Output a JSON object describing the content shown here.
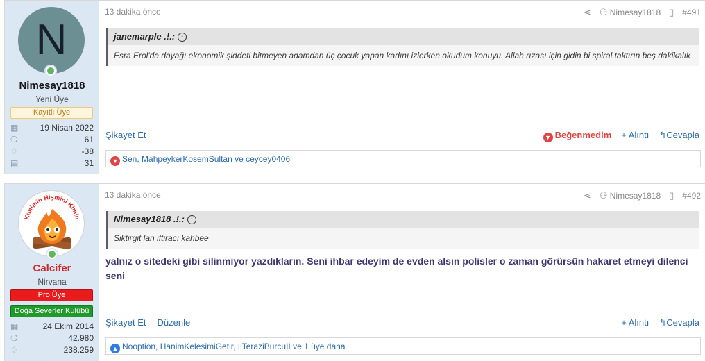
{
  "post1": {
    "user": {
      "avatar_letter": "N",
      "avatar_color": "#6b8f92",
      "username": "Nimesay1818",
      "user_title": "Yeni Üye",
      "banner": "Kayıtlı Üye",
      "stats": [
        {
          "icon": "calendar-icon",
          "value": "19 Nisan 2022"
        },
        {
          "icon": "messages-icon",
          "value": "61"
        },
        {
          "icon": "thumbs-up-icon",
          "value": "-38"
        },
        {
          "icon": "id-card-icon",
          "value": "31"
        }
      ]
    },
    "time": "13 dakika önce",
    "author": "Nimesay1818",
    "number": "#491",
    "quote": {
      "author": "janemarple .!.:",
      "text": "Esra Erol'da dayağı ekonomik şiddeti bitmeyen adamdan üç çocuk yapan kadını izlerken okudum konuyu. Allah rızası için gidin bi spiral taktırın beş dakikalık"
    },
    "footer": {
      "report": "Şikayet Et",
      "dislike": "Beğenmedim",
      "quote": "+ Alıntı",
      "reply": "Cevapla"
    },
    "reactions": "Sen, MahpeykerKosemSultan ve ceycey0406"
  },
  "post2": {
    "user": {
      "avatar_text": "Kimimin Hişmini Kimin",
      "username": "Calcifer",
      "username_color": "#cc2a2a",
      "user_title": "Nirvana",
      "banners": [
        "Pro Üye",
        "Doğa Severler Kulübü"
      ],
      "stats": [
        {
          "icon": "calendar-icon",
          "value": "24 Ekim 2014"
        },
        {
          "icon": "messages-icon",
          "value": "42.980"
        },
        {
          "icon": "thumbs-up-icon",
          "value": "238.259"
        }
      ]
    },
    "time": "13 dakika önce",
    "author": "Nimesay1818",
    "number": "#492",
    "quote": {
      "author": "Nimesay1818 .!.:",
      "text": "Siktirgit lan iftiracı kahbee"
    },
    "message": "yalnız o sitedeki gibi silinmiyor yazdıkların. Seni ihbar edeyim de evden alsın polisler o zaman görürsün hakaret etmeyi dilenci seni",
    "footer": {
      "report": "Şikayet Et",
      "edit": "Düzenle",
      "quote": "+ Alıntı",
      "reply": "Cevapla"
    },
    "reactions": "Nooption, HanimKelesimiGetir, IlTeraziBurcuII ve 1 üye daha"
  }
}
